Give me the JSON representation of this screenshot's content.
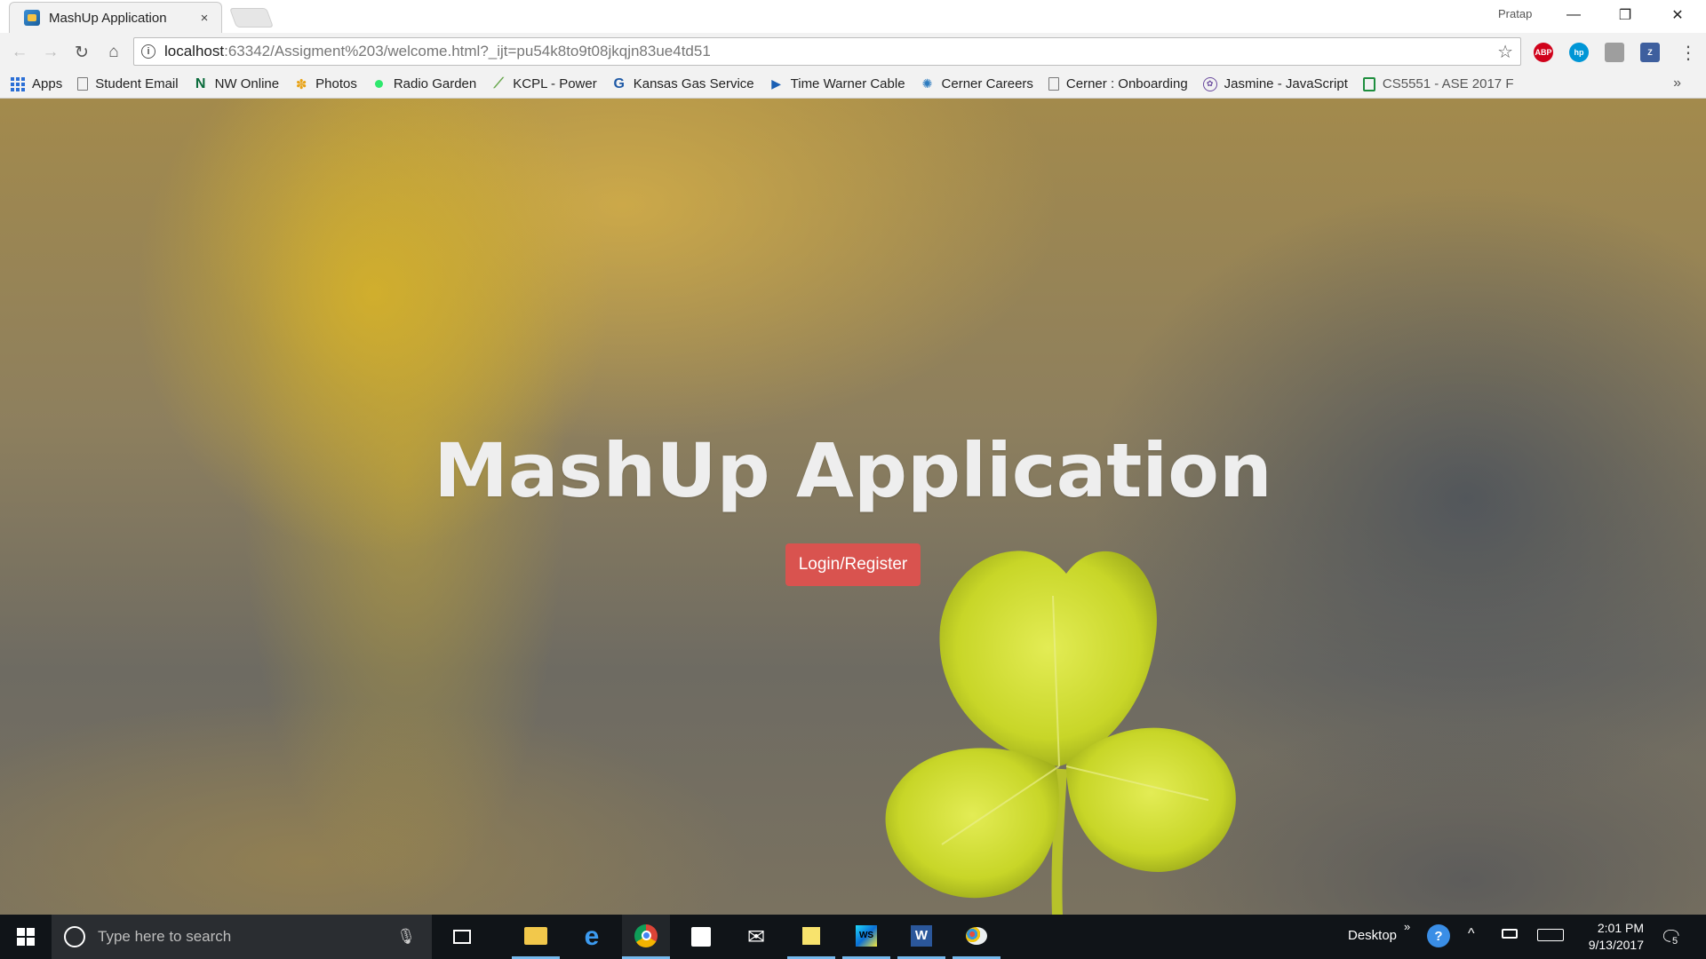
{
  "browser": {
    "tab_title": "MashUp Application",
    "tab_close": "×",
    "profile_name": "Pratap",
    "window_controls": {
      "minimize": "—",
      "restore": "❐",
      "close": "✕"
    },
    "address": {
      "host": "localhost",
      "rest": ":63342/Assigment%203/welcome.html?_ijt=pu54k8to9t08jkqjn83ue4td51"
    },
    "extensions": [
      {
        "name": "adblock-plus-icon",
        "label": "ABP",
        "color": "#d0021b"
      },
      {
        "name": "hp-icon",
        "label": "hp",
        "color": "#0096d6"
      },
      {
        "name": "pdf-icon",
        "label": "",
        "color": "#9e9e9e"
      },
      {
        "name": "zotero-icon",
        "label": "Z",
        "color": "#3e5f9e"
      }
    ],
    "bookmarks": [
      {
        "label": "Apps",
        "icon": "apps-grid-icon"
      },
      {
        "label": "Student Email",
        "icon": "page-icon"
      },
      {
        "label": "NW Online",
        "icon": "nw-icon"
      },
      {
        "label": "Photos",
        "icon": "photos-icon"
      },
      {
        "label": "Radio Garden",
        "icon": "radio-garden-icon"
      },
      {
        "label": "KCPL - Power",
        "icon": "kcpl-icon"
      },
      {
        "label": "Kansas Gas Service",
        "icon": "kansas-gas-icon"
      },
      {
        "label": "Time Warner Cable",
        "icon": "twc-icon"
      },
      {
        "label": "Cerner Careers",
        "icon": "cerner-icon"
      },
      {
        "label": "Cerner : Onboarding",
        "icon": "page-icon"
      },
      {
        "label": "Jasmine - JavaScript",
        "icon": "jasmine-icon"
      },
      {
        "label": "CS5551 - ASE 2017 F",
        "icon": "sheets-icon"
      }
    ],
    "bookmarks_overflow": "»"
  },
  "page": {
    "title": "MashUp Application",
    "cta_label": "Login/Register",
    "cta_color": "#d9534f"
  },
  "taskbar": {
    "search_placeholder": "Type here to search",
    "desktop_label": "Desktop",
    "desktop_chevron": "»",
    "time": "2:01 PM",
    "date": "9/13/2017",
    "notification_count": "5"
  }
}
